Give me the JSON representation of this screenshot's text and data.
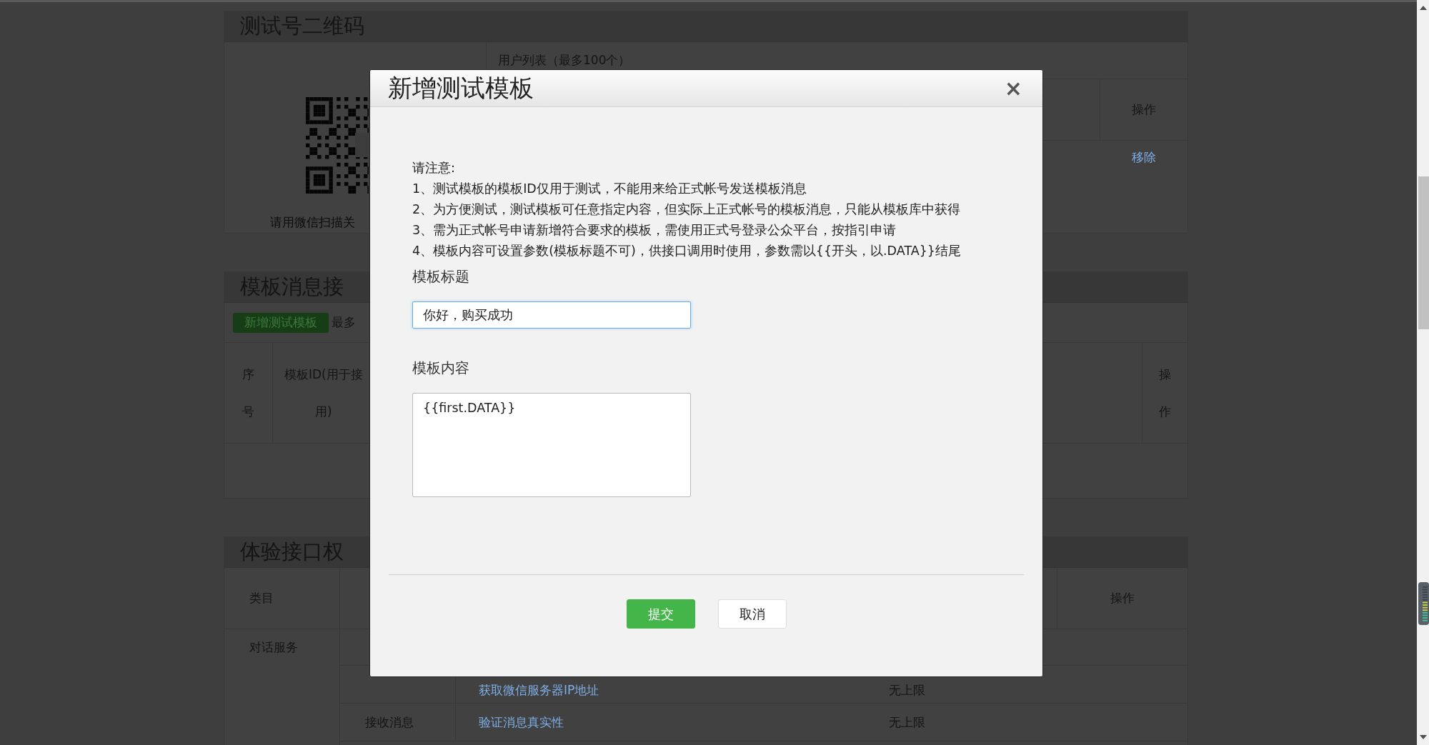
{
  "background_page": {
    "qr_section": {
      "title": "测试号二维码",
      "qr_caption": "请用微信扫描关",
      "user_list_title": "用户列表（最多100个）",
      "table": {
        "columns": [
          "操作"
        ],
        "rows": [
          [
            "移除"
          ]
        ]
      }
    },
    "template_section": {
      "title": "模板消息接",
      "add_button": "新增测试模板",
      "note": "最多",
      "table": {
        "columns": [
          [
            "序",
            "号"
          ],
          [
            "模板ID(用于接",
            "用)"
          ],
          [
            "操",
            "作"
          ]
        ]
      }
    },
    "permissions_section": {
      "title": "体验接口权",
      "columns": [
        "类目",
        "操作"
      ],
      "rows": [
        {
          "category": "对话服务"
        },
        {
          "api": "获取微信服务器IP地址",
          "limit": "无上限"
        },
        {
          "item": "接收消息",
          "api": "验证消息真实性",
          "limit": "无上限"
        }
      ]
    }
  },
  "dialog": {
    "title": "新增测试模板",
    "close": "×",
    "notes_heading": "请注意:",
    "notes": [
      "1、测试模板的模板ID仅用于测试，不能用来给正式帐号发送模板消息",
      "2、为方便测试，测试模板可任意指定内容，但实际上正式帐号的模板消息，只能从模板库中获得",
      "3、需为正式帐号申请新增符合要求的模板，需使用正式号登录公众平台，按指引申请",
      "4、模板内容可设置参数(模板标题不可)，供接口调用时使用，参数需以{{开头，以.DATA}}结尾"
    ],
    "fields": [
      {
        "label": "模板标题",
        "kind": "input",
        "value": "你好，购买成功",
        "focused": true
      },
      {
        "label": "模板内容",
        "kind": "textarea",
        "value": "{{first.DATA}}",
        "focused": false
      }
    ],
    "buttons": [
      {
        "label": "提交",
        "kind": "primary"
      },
      {
        "label": "取消",
        "kind": "default"
      }
    ]
  }
}
